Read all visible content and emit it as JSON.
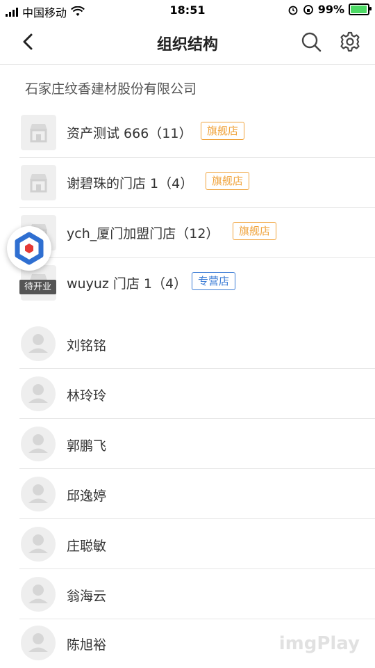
{
  "status": {
    "carrier": "中国移动",
    "time": "18:51",
    "battery": "99%"
  },
  "nav": {
    "title": "组织结构"
  },
  "company": {
    "name": "石家庄纹香建材股份有限公司"
  },
  "stores": [
    {
      "name": "资产测试 666（11）",
      "tag": "旗舰店",
      "tag_type": "flagship"
    },
    {
      "name": "谢碧珠的门店 1（4）",
      "tag": "旗舰店",
      "tag_type": "flagship"
    },
    {
      "name": "ych_厦门加盟门店（12）",
      "tag": "旗舰店",
      "tag_type": "flagship"
    },
    {
      "name": "wuyuz 门店 1（4）",
      "tag": "专营店",
      "tag_type": "direct",
      "badge": "待开业"
    }
  ],
  "people": [
    {
      "name": "刘铭铭"
    },
    {
      "name": "林玲玲"
    },
    {
      "name": "郭鹏飞"
    },
    {
      "name": "邱逸婷"
    },
    {
      "name": "庄聪敏"
    },
    {
      "name": "翁海云"
    },
    {
      "name": "陈旭裕"
    }
  ],
  "watermark": "imgPlay",
  "colors": {
    "flagship_tag": "#f0a33b",
    "direct_tag": "#3a7bd5",
    "battery": "#4cd964"
  },
  "icons": {
    "back": "chevron-left-icon",
    "search": "search-icon",
    "settings": "gear-icon",
    "store": "store-icon",
    "avatar": "user-icon"
  }
}
